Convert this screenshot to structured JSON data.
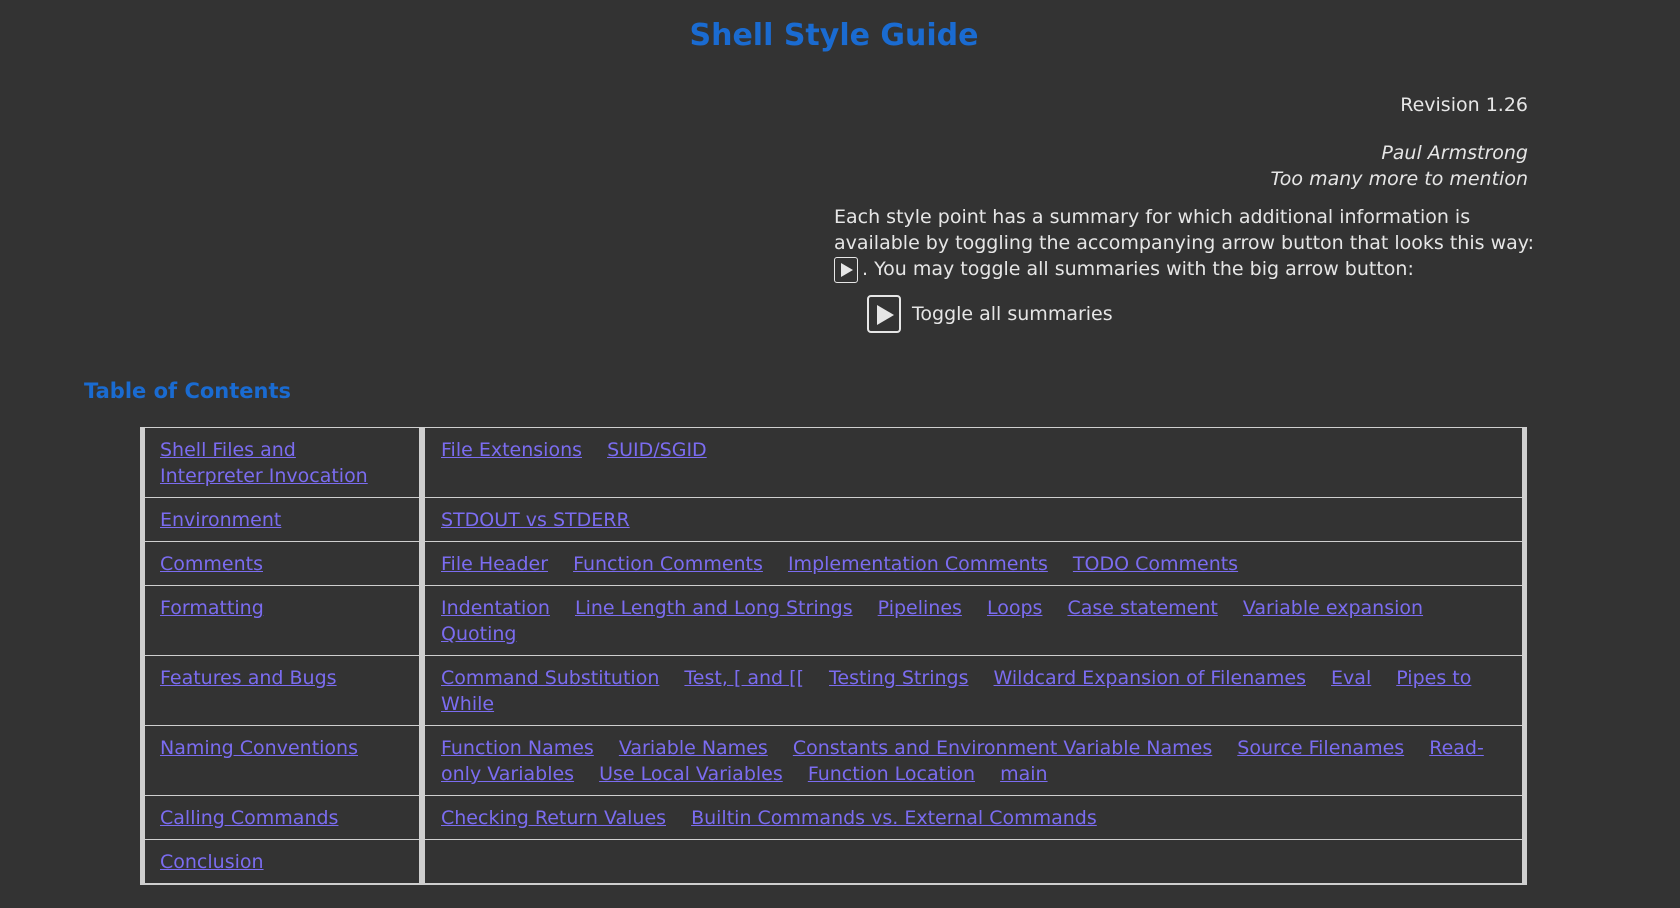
{
  "header": {
    "title": "Shell Style Guide",
    "revision": "Revision 1.26",
    "authors": [
      "Paul Armstrong",
      "Too many more to mention"
    ]
  },
  "intro": {
    "text_before": "Each style point has a summary for which additional information is available by toggling the accompanying arrow button that looks this way:",
    "text_after": ". You may toggle all summaries with the big arrow button:",
    "toggle_label": "Toggle all summaries"
  },
  "toc": {
    "heading": "Table of Contents",
    "rows": [
      {
        "category": "Shell Files and Interpreter Invocation",
        "items": [
          "File Extensions",
          "SUID/SGID"
        ]
      },
      {
        "category": "Environment",
        "items": [
          "STDOUT vs STDERR"
        ]
      },
      {
        "category": "Comments",
        "items": [
          "File Header",
          "Function Comments",
          "Implementation Comments",
          "TODO Comments"
        ]
      },
      {
        "category": "Formatting",
        "items": [
          "Indentation",
          "Line Length and Long Strings",
          "Pipelines",
          "Loops",
          "Case statement",
          "Variable expansion",
          "Quoting"
        ]
      },
      {
        "category": "Features and Bugs",
        "items": [
          "Command Substitution",
          "Test, [ and [[",
          "Testing Strings",
          "Wildcard Expansion of Filenames",
          "Eval",
          "Pipes to While"
        ]
      },
      {
        "category": "Naming Conventions",
        "items": [
          "Function Names",
          "Variable Names",
          "Constants and Environment Variable Names",
          "Source Filenames",
          "Read-only Variables",
          "Use Local Variables",
          "Function Location",
          "main"
        ]
      },
      {
        "category": "Calling Commands",
        "items": [
          "Checking Return Values",
          "Builtin Commands vs. External Commands"
        ]
      },
      {
        "category": "Conclusion",
        "items": []
      }
    ]
  },
  "colors": {
    "background": "#333333",
    "heading": "#1a6bd1",
    "link": "#7b6cf0",
    "text": "#e6e6e6",
    "table_border": "#cfcfcf"
  },
  "icons": {
    "small_toggle": "play-arrow-icon",
    "big_toggle": "play-arrow-icon"
  }
}
